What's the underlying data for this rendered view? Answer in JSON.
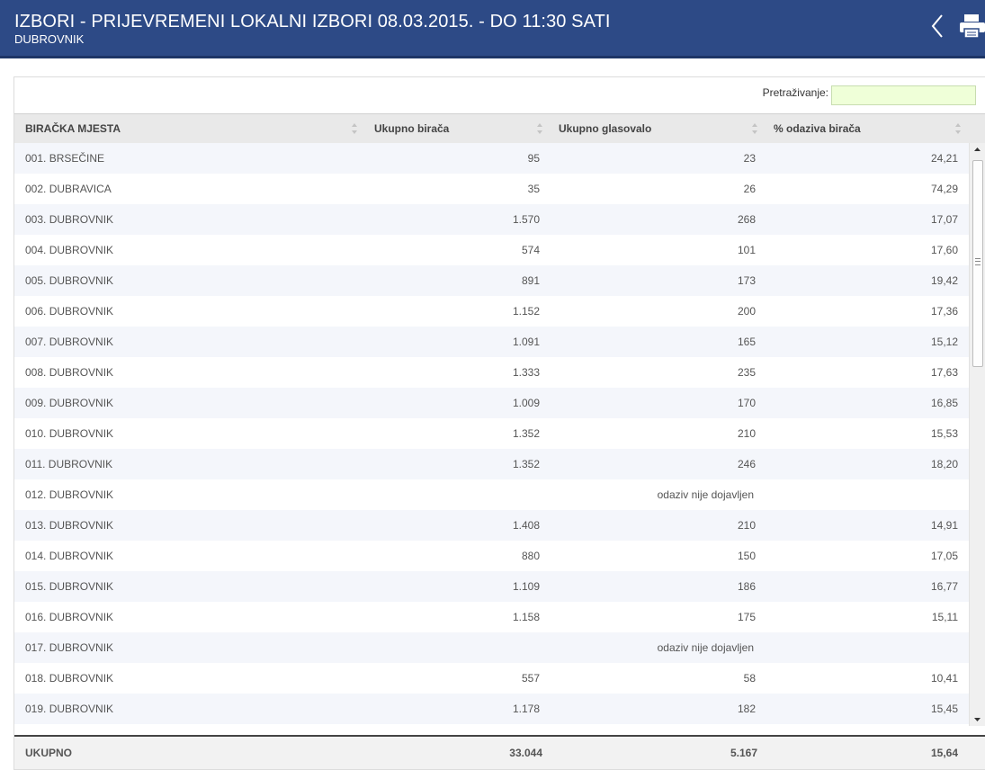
{
  "header": {
    "title": "IZBORI - PRIJEVREMENI LOKALNI IZBORI 08.03.2015. - DO 11:30 SATI",
    "subtitle": "DUBROVNIK",
    "bg_color": "#2d4a86"
  },
  "search": {
    "label": "Pretraživanje:",
    "value": "",
    "placeholder": ""
  },
  "table": {
    "columns": [
      "BIRAČKA MJESTA",
      "Ukupno birača",
      "Ukupno glasovalo",
      "% odaziva birača"
    ],
    "rows": [
      {
        "name": "001. BRSEČINE",
        "voters": "95",
        "voted": "23",
        "pct": "24,21"
      },
      {
        "name": "002. DUBRAVICA",
        "voters": "35",
        "voted": "26",
        "pct": "74,29"
      },
      {
        "name": "003. DUBROVNIK",
        "voters": "1.570",
        "voted": "268",
        "pct": "17,07"
      },
      {
        "name": "004. DUBROVNIK",
        "voters": "574",
        "voted": "101",
        "pct": "17,60"
      },
      {
        "name": "005. DUBROVNIK",
        "voters": "891",
        "voted": "173",
        "pct": "19,42"
      },
      {
        "name": "006. DUBROVNIK",
        "voters": "1.152",
        "voted": "200",
        "pct": "17,36"
      },
      {
        "name": "007. DUBROVNIK",
        "voters": "1.091",
        "voted": "165",
        "pct": "15,12"
      },
      {
        "name": "008. DUBROVNIK",
        "voters": "1.333",
        "voted": "235",
        "pct": "17,63"
      },
      {
        "name": "009. DUBROVNIK",
        "voters": "1.009",
        "voted": "170",
        "pct": "16,85"
      },
      {
        "name": "010. DUBROVNIK",
        "voters": "1.352",
        "voted": "210",
        "pct": "15,53"
      },
      {
        "name": "011. DUBROVNIK",
        "voters": "1.352",
        "voted": "246",
        "pct": "18,20"
      },
      {
        "name": "012. DUBROVNIK",
        "note": "odaziv nije dojavljen"
      },
      {
        "name": "013. DUBROVNIK",
        "voters": "1.408",
        "voted": "210",
        "pct": "14,91"
      },
      {
        "name": "014. DUBROVNIK",
        "voters": "880",
        "voted": "150",
        "pct": "17,05"
      },
      {
        "name": "015. DUBROVNIK",
        "voters": "1.109",
        "voted": "186",
        "pct": "16,77"
      },
      {
        "name": "016. DUBROVNIK",
        "voters": "1.158",
        "voted": "175",
        "pct": "15,11"
      },
      {
        "name": "017. DUBROVNIK",
        "note": "odaziv nije dojavljen"
      },
      {
        "name": "018. DUBROVNIK",
        "voters": "557",
        "voted": "58",
        "pct": "10,41"
      },
      {
        "name": "019. DUBROVNIK",
        "voters": "1.178",
        "voted": "182",
        "pct": "15,45"
      }
    ],
    "footer": {
      "label": "UKUPNO",
      "voters": "33.044",
      "voted": "5.167",
      "pct": "15,64"
    }
  },
  "icons": [
    "back-chevron-icon",
    "printer-icon",
    "sort-icon"
  ]
}
